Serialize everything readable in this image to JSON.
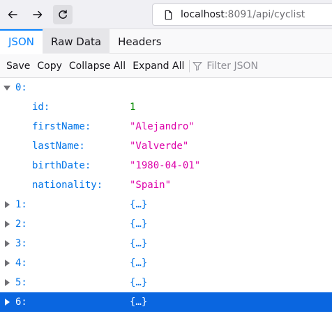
{
  "browser": {
    "url_host": "localhost",
    "url_path": ":8091/api/cyclist",
    "icons": {
      "back": "arrow-left-icon",
      "forward": "arrow-right-icon",
      "reload": "reload-icon",
      "page": "page-info-icon"
    }
  },
  "viewer": {
    "tabs": [
      {
        "label": "JSON",
        "active": true
      },
      {
        "label": "Raw Data",
        "active": false
      },
      {
        "label": "Headers",
        "active": false
      }
    ],
    "actions": [
      "Save",
      "Copy",
      "Collapse All",
      "Expand All"
    ],
    "filter_placeholder": "Filter JSON"
  },
  "tree": {
    "root_key": "0:",
    "fields": [
      {
        "key": "id:",
        "value": "1",
        "type": "number"
      },
      {
        "key": "firstName:",
        "value": "\"Alejandro\"",
        "type": "string"
      },
      {
        "key": "lastName:",
        "value": "\"Valverde\"",
        "type": "string"
      },
      {
        "key": "birthDate:",
        "value": "\"1980-04-01\"",
        "type": "string"
      },
      {
        "key": "nationality:",
        "value": "\"Spain\"",
        "type": "string"
      }
    ],
    "collapsed": [
      {
        "key": "1:",
        "value": "{…}",
        "selected": false
      },
      {
        "key": "2:",
        "value": "{…}",
        "selected": false
      },
      {
        "key": "3:",
        "value": "{…}",
        "selected": false
      },
      {
        "key": "4:",
        "value": "{…}",
        "selected": false
      },
      {
        "key": "5:",
        "value": "{…}",
        "selected": false
      },
      {
        "key": "6:",
        "value": "{…}",
        "selected": true
      }
    ]
  },
  "colors": {
    "accent": "#0a84ff",
    "key": "#0074e8",
    "string": "#dd00a9",
    "number": "#058b00",
    "selection": "#0a66e0"
  }
}
